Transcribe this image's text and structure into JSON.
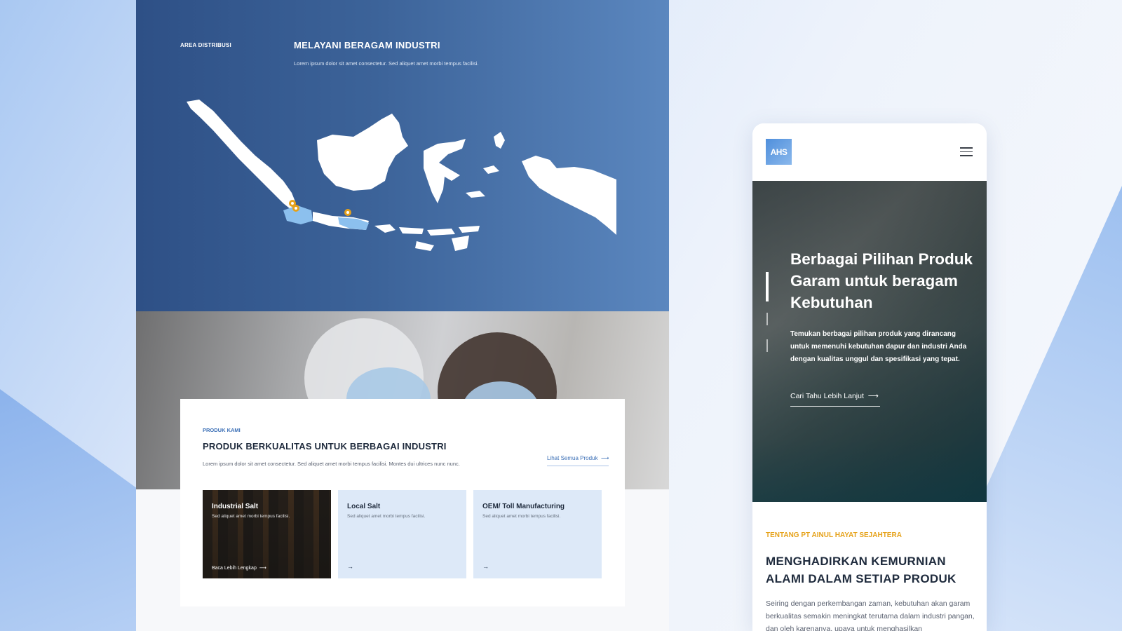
{
  "desktop": {
    "map": {
      "area_label": "AREA DISTRIBUSI",
      "title": "MELAYANI BERAGAM INDUSTRI",
      "description": "Lorem ipsum dolor sit amet consectetur. Sed aliquet amet morbi tempus facilisi."
    },
    "products": {
      "kicker": "PRODUK KAMI",
      "title": "PRODUK BERKUALITAS UNTUK BERBAGAI INDUSTRI",
      "description": "Lorem ipsum dolor sit amet consectetur. Sed aliquet amet morbi tempus facilisi. Montes dui ultrices nunc nunc.",
      "see_all": "Lihat Semua Produk",
      "tiles": [
        {
          "title": "Industrial Salt",
          "subtitle": "Sed aliquet amet morbi tempus facilisi.",
          "link": "Baca Lebih Lengkap"
        },
        {
          "title": "Local Salt",
          "subtitle": "Sed aliquet amet morbi tempus facilisi."
        },
        {
          "title": "OEM/ Toll Manufacturing",
          "subtitle": "Sed aliquet amet morbi tempus facilisi."
        }
      ]
    }
  },
  "mobile": {
    "logo_text": "AHS",
    "hero": {
      "title": "Berbagai Pilihan Produk Garam untuk beragam Kebutuhan",
      "description": "Temukan berbagai pilihan produk yang dirancang untuk memenuhi kebutuhan dapur dan industri Anda dengan kualitas unggul dan spesifikasi yang tepat.",
      "cta": "Cari Tahu Lebih Lanjut"
    },
    "about": {
      "kicker": "TENTANG PT AINUL HAYAT SEJAHTERA",
      "title": "MENGHADIRKAN KEMURNIAN ALAMI DALAM SETIAP PRODUK",
      "description": "Seiring dengan perkembangan zaman, kebutuhan akan garam berkualitas semakin meningkat terutama dalam industri pangan, dan oleh karenanya, upaya untuk menghasilkan"
    }
  },
  "colors": {
    "accent_blue": "#3b6fb6",
    "accent_orange": "#e6a21a",
    "map_bg": "#3c6399"
  },
  "icons": [
    "map-pin-icon",
    "arrow-right-icon",
    "hamburger-menu-icon"
  ]
}
